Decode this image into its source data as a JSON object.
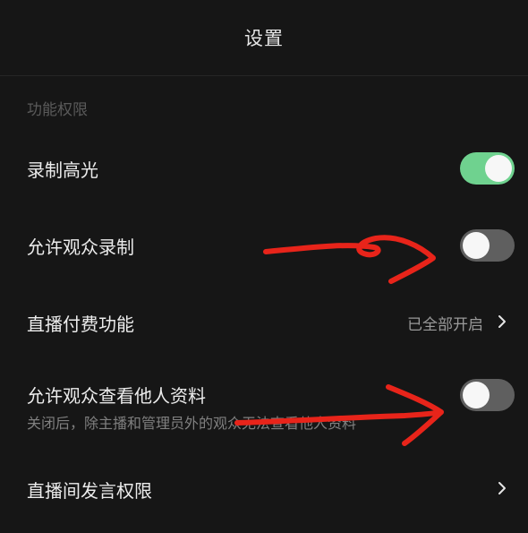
{
  "header": {
    "title": "设置"
  },
  "section": {
    "title": "功能权限"
  },
  "rows": [
    {
      "label": "录制高光",
      "toggle": "on"
    },
    {
      "label": "允许观众录制",
      "toggle": "off"
    },
    {
      "label": "直播付费功能",
      "value": "已全部开启",
      "icon": "chevron-right-icon"
    },
    {
      "label": "允许观众查看他人资料",
      "sublabel": "关闭后，除主播和管理员外的观众无法查看他人资料",
      "toggle": "off"
    },
    {
      "label": "直播间发言权限",
      "icon": "chevron-right-icon"
    }
  ],
  "colors": {
    "background": "#161616",
    "toggle_on": "#6fd28f",
    "toggle_off": "#5f5f5f",
    "annotation": "#e8241a"
  }
}
